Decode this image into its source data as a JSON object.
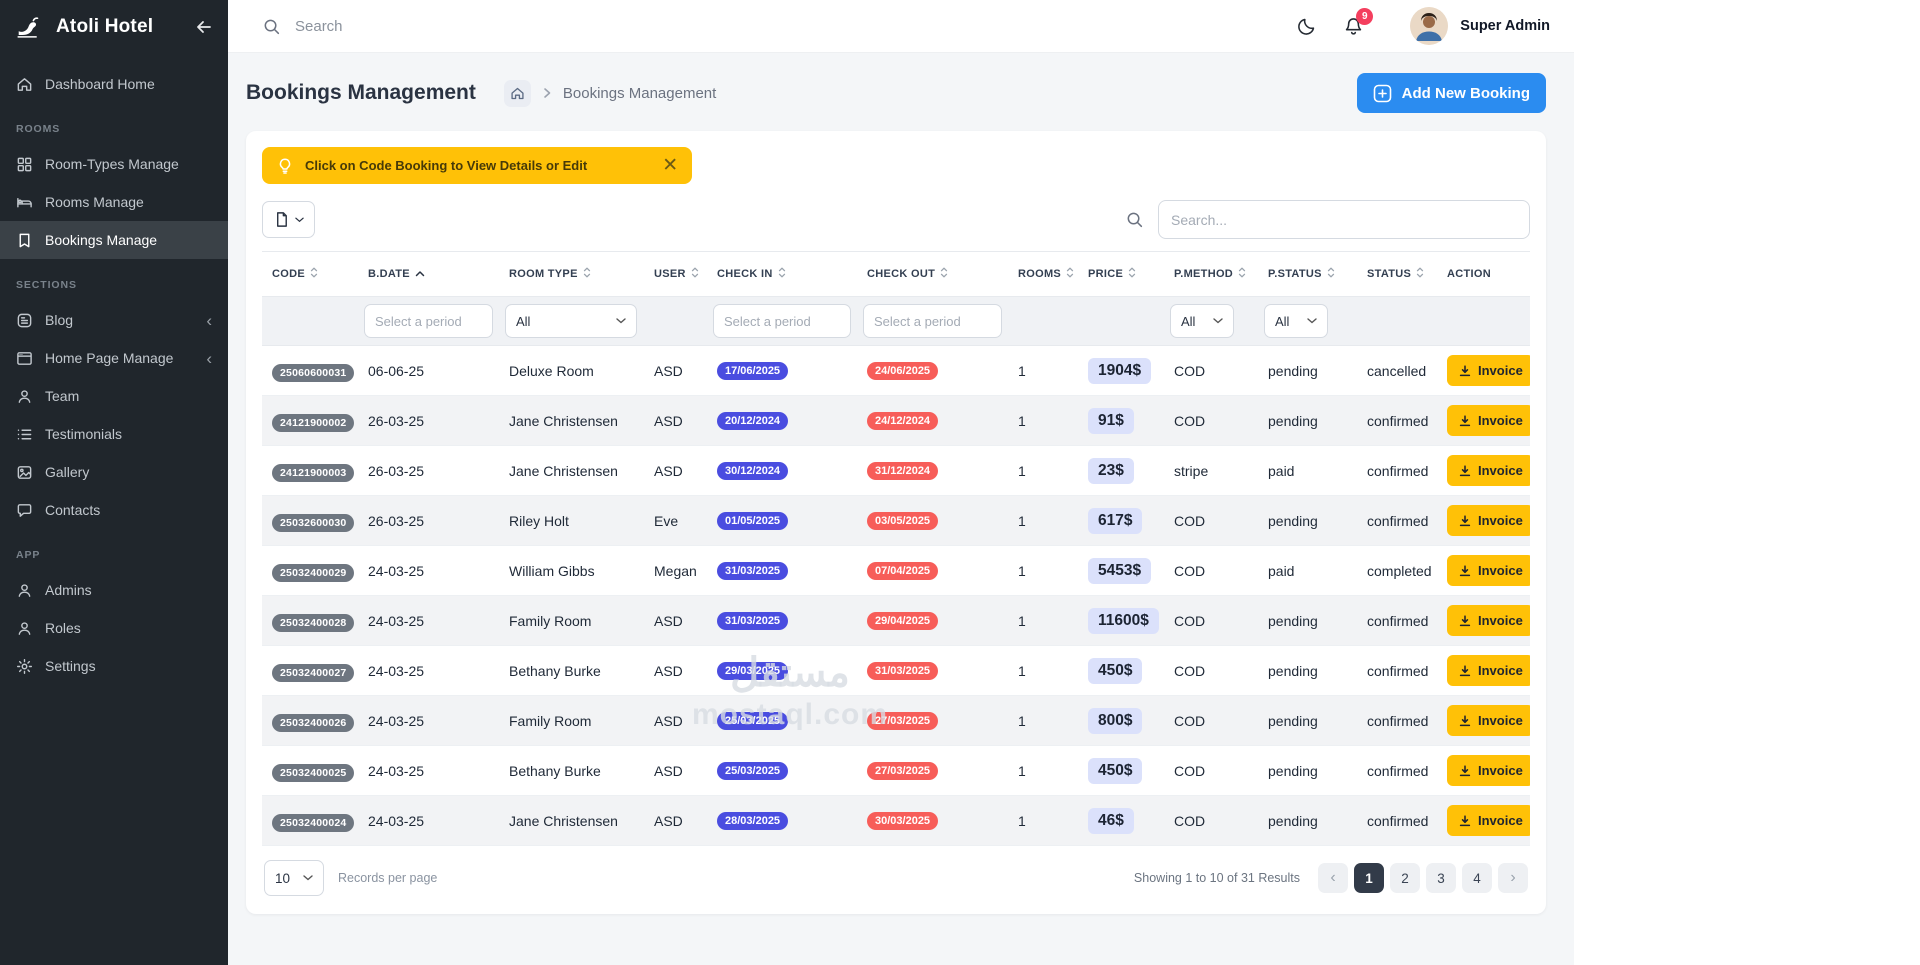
{
  "sidebar": {
    "brand": "Atoli Hotel",
    "groups": [
      {
        "heading": null,
        "items": [
          {
            "id": "dashboard-home",
            "icon": "home",
            "label": "Dashboard Home"
          }
        ]
      },
      {
        "heading": "ROOMS",
        "items": [
          {
            "id": "room-types-manage",
            "icon": "grid",
            "label": "Room-Types Manage"
          },
          {
            "id": "rooms-manage",
            "icon": "bed",
            "label": "Rooms Manage"
          },
          {
            "id": "bookings-manage",
            "icon": "bookmark",
            "label": "Bookings Manage",
            "active": true
          }
        ]
      },
      {
        "heading": "SECTIONS",
        "items": [
          {
            "id": "blog",
            "icon": "blog",
            "label": "Blog",
            "collapsible": true
          },
          {
            "id": "home-page-manage",
            "icon": "browser",
            "label": "Home Page Manage",
            "collapsible": true
          },
          {
            "id": "team",
            "icon": "user",
            "label": "Team"
          },
          {
            "id": "testimonials",
            "icon": "list",
            "label": "Testimonials"
          },
          {
            "id": "gallery",
            "icon": "image",
            "label": "Gallery"
          },
          {
            "id": "contacts",
            "icon": "chat",
            "label": "Contacts"
          }
        ]
      },
      {
        "heading": "APP",
        "items": [
          {
            "id": "admins",
            "icon": "user",
            "label": "Admins"
          },
          {
            "id": "roles",
            "icon": "user",
            "label": "Roles"
          },
          {
            "id": "settings",
            "icon": "gear",
            "label": "Settings"
          }
        ]
      }
    ]
  },
  "header": {
    "search_placeholder": "Search",
    "notification_count": "9",
    "user_name": "Super Admin"
  },
  "page": {
    "title": "Bookings Management",
    "breadcrumb_current": "Bookings Management",
    "add_button_label": "Add New Booking",
    "alert_text": "Click on Code Booking to View Details or Edit"
  },
  "table": {
    "search_placeholder": "Search...",
    "invoice_label": "Invoice",
    "columns": [
      {
        "label": "CODE",
        "sort": "both",
        "filter": "none"
      },
      {
        "label": "B.DATE",
        "sort": "asc",
        "filter": "date",
        "filter_placeholder": "Select a period"
      },
      {
        "label": "ROOM TYPE",
        "sort": "both",
        "filter": "select",
        "filter_value": "All"
      },
      {
        "label": "USER",
        "sort": "both",
        "filter": "none"
      },
      {
        "label": "CHECK IN",
        "sort": "both",
        "filter": "date",
        "filter_placeholder": "Select a period"
      },
      {
        "label": "CHECK OUT",
        "sort": "both",
        "filter": "date",
        "filter_placeholder": "Select a period"
      },
      {
        "label": "ROOMS",
        "sort": "both",
        "filter": "none"
      },
      {
        "label": "PRICE",
        "sort": "both",
        "filter": "none"
      },
      {
        "label": "P.METHOD",
        "sort": "both",
        "filter": "select",
        "filter_value": "All"
      },
      {
        "label": "P.STATUS",
        "sort": "both",
        "filter": "select",
        "filter_value": "All"
      },
      {
        "label": "STATUS",
        "sort": "both",
        "filter": "none"
      },
      {
        "label": "ACTION",
        "sort": "none",
        "filter": "none"
      }
    ],
    "rows": [
      {
        "code": "25060600031",
        "bdate": "06-06-25",
        "room_type": "Deluxe Room",
        "user": "ASD",
        "check_in": "17/06/2025",
        "check_out": "24/06/2025",
        "rooms": "1",
        "price": "1904$",
        "p_method": "COD",
        "p_status": "pending",
        "status": "cancelled"
      },
      {
        "code": "24121900002",
        "bdate": "26-03-25",
        "room_type": "Jane Christensen",
        "user": "ASD",
        "check_in": "20/12/2024",
        "check_out": "24/12/2024",
        "rooms": "1",
        "price": "91$",
        "p_method": "COD",
        "p_status": "pending",
        "status": "confirmed"
      },
      {
        "code": "24121900003",
        "bdate": "26-03-25",
        "room_type": "Jane Christensen",
        "user": "ASD",
        "check_in": "30/12/2024",
        "check_out": "31/12/2024",
        "rooms": "1",
        "price": "23$",
        "p_method": "stripe",
        "p_status": "paid",
        "status": "confirmed"
      },
      {
        "code": "25032600030",
        "bdate": "26-03-25",
        "room_type": "Riley Holt",
        "user": "Eve",
        "check_in": "01/05/2025",
        "check_out": "03/05/2025",
        "rooms": "1",
        "price": "617$",
        "p_method": "COD",
        "p_status": "pending",
        "status": "confirmed"
      },
      {
        "code": "25032400029",
        "bdate": "24-03-25",
        "room_type": "William Gibbs",
        "user": "Megan",
        "check_in": "31/03/2025",
        "check_out": "07/04/2025",
        "rooms": "1",
        "price": "5453$",
        "p_method": "COD",
        "p_status": "paid",
        "status": "completed"
      },
      {
        "code": "25032400028",
        "bdate": "24-03-25",
        "room_type": "Family Room",
        "user": "ASD",
        "check_in": "31/03/2025",
        "check_out": "29/04/2025",
        "rooms": "1",
        "price": "11600$",
        "p_method": "COD",
        "p_status": "pending",
        "status": "confirmed"
      },
      {
        "code": "25032400027",
        "bdate": "24-03-25",
        "room_type": "Bethany Burke",
        "user": "ASD",
        "check_in": "29/03/2025",
        "check_out": "31/03/2025",
        "rooms": "1",
        "price": "450$",
        "p_method": "COD",
        "p_status": "pending",
        "status": "confirmed"
      },
      {
        "code": "25032400026",
        "bdate": "24-03-25",
        "room_type": "Family Room",
        "user": "ASD",
        "check_in": "25/03/2025",
        "check_out": "27/03/2025",
        "rooms": "1",
        "price": "800$",
        "p_method": "COD",
        "p_status": "pending",
        "status": "confirmed"
      },
      {
        "code": "25032400025",
        "bdate": "24-03-25",
        "room_type": "Bethany Burke",
        "user": "ASD",
        "check_in": "25/03/2025",
        "check_out": "27/03/2025",
        "rooms": "1",
        "price": "450$",
        "p_method": "COD",
        "p_status": "pending",
        "status": "confirmed"
      },
      {
        "code": "25032400024",
        "bdate": "24-03-25",
        "room_type": "Jane Christensen",
        "user": "ASD",
        "check_in": "28/03/2025",
        "check_out": "30/03/2025",
        "rooms": "1",
        "price": "46$",
        "p_method": "COD",
        "p_status": "pending",
        "status": "confirmed"
      }
    ]
  },
  "pagination": {
    "per_page": "10",
    "per_page_label": "Records per page",
    "summary": "Showing 1 to 10 of 31 Results",
    "pages": [
      "1",
      "2",
      "3",
      "4"
    ],
    "active_page": "1",
    "prev_icon": "‹",
    "next_icon": "›"
  },
  "watermark": {
    "line1": "مستقل",
    "line2": "mostaql.com"
  },
  "colors": {
    "accent_blue": "#2b8cf0",
    "alert_yellow": "#ffc107",
    "invoice_yellow": "#ffc107",
    "check_in_badge": "#4a4de0",
    "check_out_badge": "#f75d59",
    "code_badge": "#6e7680",
    "price_chip_bg": "#dbe1fb",
    "notification_badge": "#f43f5e",
    "sidebar_bg": "#20262c"
  }
}
